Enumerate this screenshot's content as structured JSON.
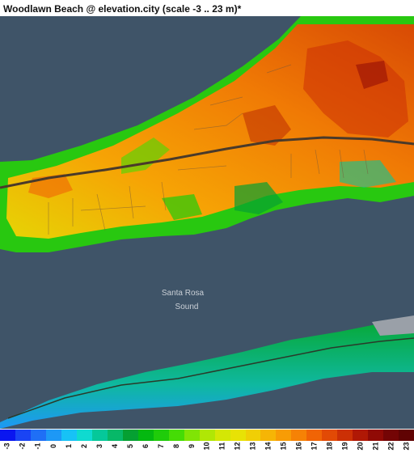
{
  "title": "Woodlawn Beach @ elevation.city (scale -3 .. 23 m)*",
  "map": {
    "water_color": "#3f5468",
    "place_label_line1": "Santa Rosa",
    "place_label_line2": "Sound"
  },
  "legend": {
    "values": [
      "-3",
      "-2",
      "-1",
      "0",
      "1",
      "2",
      "3",
      "4",
      "5",
      "6",
      "7",
      "8",
      "9",
      "10",
      "11",
      "12",
      "13",
      "14",
      "15",
      "16",
      "17",
      "18",
      "19",
      "20",
      "21",
      "22",
      "23"
    ],
    "colors": [
      "#0a16f0",
      "#1a44f4",
      "#1f6ff6",
      "#1d98f6",
      "#17c2f6",
      "#0fdad0",
      "#05c89a",
      "#07b868",
      "#05a032",
      "#04b810",
      "#1fcc0a",
      "#45dc05",
      "#80e405",
      "#b0e705",
      "#d4e705",
      "#e8e205",
      "#f0cf05",
      "#f6b505",
      "#f89c05",
      "#f68205",
      "#f06405",
      "#e24a05",
      "#cc3005",
      "#b01805",
      "#900a05",
      "#740505",
      "#600303"
    ]
  }
}
